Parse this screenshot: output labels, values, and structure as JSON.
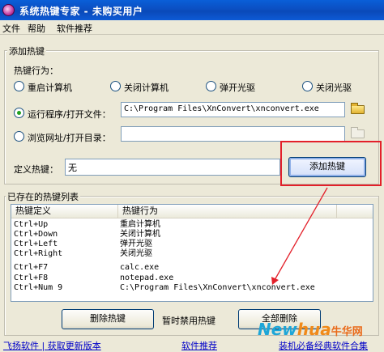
{
  "window": {
    "title": "系统热键专家 - 未购买用户"
  },
  "menu": [
    "文件",
    "帮助",
    "软件推荐"
  ],
  "add_group": {
    "title": "添加热键",
    "action_label": "热键行为：",
    "radios": [
      "重启计算机",
      "关闭计算机",
      "弹开光驱",
      "关闭光驱"
    ],
    "run_label": "运行程序/打开文件：",
    "run_path": "C:\\Program Files\\XnConvert\\xnconvert.exe",
    "browse_label": "浏览网址/打开目录：",
    "browse_value": "",
    "hotkey_label": "定义热键：",
    "hotkey_value": "无",
    "add_button": "添加热键"
  },
  "list_group": {
    "title": "已存在的热键列表",
    "columns": [
      "热键定义",
      "热键行为"
    ],
    "rows": [
      [
        "Ctrl+Up",
        "重启计算机"
      ],
      [
        "Ctrl+Down",
        "关闭计算机"
      ],
      [
        "Ctrl+Left",
        "弹开光驱"
      ],
      [
        "Ctrl+Right",
        "关闭光驱"
      ],
      [
        "Ctrl+F7",
        "calc.exe"
      ],
      [
        "Ctrl+F8",
        "notepad.exe"
      ],
      [
        "Ctrl+Num 9",
        "C:\\Program Files\\XnConvert\\xnconvert.exe"
      ]
    ]
  },
  "buttons": {
    "delete": "删除热键",
    "disable": "暂时禁用热键",
    "delete_all": "全部删除"
  },
  "status": {
    "link1": "飞扬软件 | 获取更新版本",
    "link2": "软件推荐",
    "link3": "装机必备经典软件合集"
  },
  "watermark": {
    "part1": "New",
    "part2": "hua",
    "part3": "牛华网"
  },
  "colors": {
    "titlebar": "#0b4fc2",
    "annotation": "#e3202a",
    "link": "#0000c8"
  }
}
